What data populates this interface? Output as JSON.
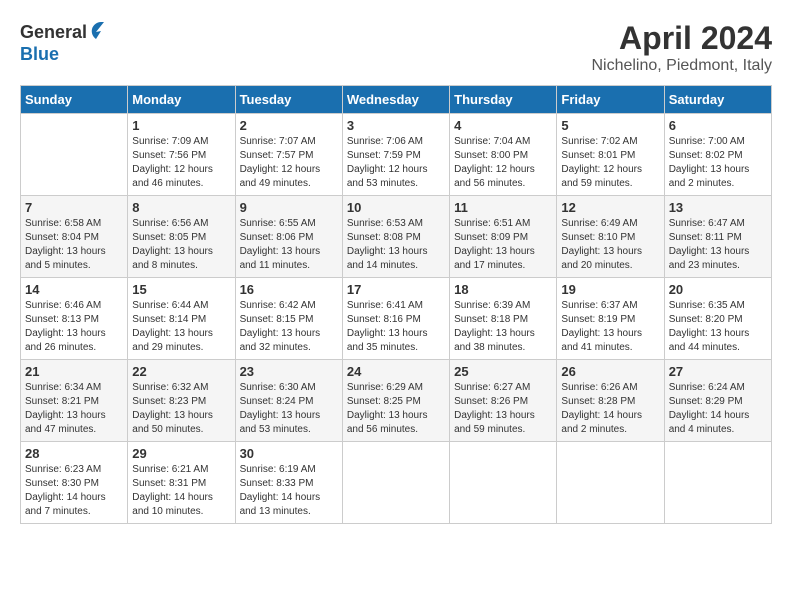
{
  "header": {
    "logo_general": "General",
    "logo_blue": "Blue",
    "month_title": "April 2024",
    "location": "Nichelino, Piedmont, Italy"
  },
  "columns": [
    "Sunday",
    "Monday",
    "Tuesday",
    "Wednesday",
    "Thursday",
    "Friday",
    "Saturday"
  ],
  "weeks": [
    [
      {
        "day": "",
        "info": ""
      },
      {
        "day": "1",
        "info": "Sunrise: 7:09 AM\nSunset: 7:56 PM\nDaylight: 12 hours\nand 46 minutes."
      },
      {
        "day": "2",
        "info": "Sunrise: 7:07 AM\nSunset: 7:57 PM\nDaylight: 12 hours\nand 49 minutes."
      },
      {
        "day": "3",
        "info": "Sunrise: 7:06 AM\nSunset: 7:59 PM\nDaylight: 12 hours\nand 53 minutes."
      },
      {
        "day": "4",
        "info": "Sunrise: 7:04 AM\nSunset: 8:00 PM\nDaylight: 12 hours\nand 56 minutes."
      },
      {
        "day": "5",
        "info": "Sunrise: 7:02 AM\nSunset: 8:01 PM\nDaylight: 12 hours\nand 59 minutes."
      },
      {
        "day": "6",
        "info": "Sunrise: 7:00 AM\nSunset: 8:02 PM\nDaylight: 13 hours\nand 2 minutes."
      }
    ],
    [
      {
        "day": "7",
        "info": "Sunrise: 6:58 AM\nSunset: 8:04 PM\nDaylight: 13 hours\nand 5 minutes."
      },
      {
        "day": "8",
        "info": "Sunrise: 6:56 AM\nSunset: 8:05 PM\nDaylight: 13 hours\nand 8 minutes."
      },
      {
        "day": "9",
        "info": "Sunrise: 6:55 AM\nSunset: 8:06 PM\nDaylight: 13 hours\nand 11 minutes."
      },
      {
        "day": "10",
        "info": "Sunrise: 6:53 AM\nSunset: 8:08 PM\nDaylight: 13 hours\nand 14 minutes."
      },
      {
        "day": "11",
        "info": "Sunrise: 6:51 AM\nSunset: 8:09 PM\nDaylight: 13 hours\nand 17 minutes."
      },
      {
        "day": "12",
        "info": "Sunrise: 6:49 AM\nSunset: 8:10 PM\nDaylight: 13 hours\nand 20 minutes."
      },
      {
        "day": "13",
        "info": "Sunrise: 6:47 AM\nSunset: 8:11 PM\nDaylight: 13 hours\nand 23 minutes."
      }
    ],
    [
      {
        "day": "14",
        "info": "Sunrise: 6:46 AM\nSunset: 8:13 PM\nDaylight: 13 hours\nand 26 minutes."
      },
      {
        "day": "15",
        "info": "Sunrise: 6:44 AM\nSunset: 8:14 PM\nDaylight: 13 hours\nand 29 minutes."
      },
      {
        "day": "16",
        "info": "Sunrise: 6:42 AM\nSunset: 8:15 PM\nDaylight: 13 hours\nand 32 minutes."
      },
      {
        "day": "17",
        "info": "Sunrise: 6:41 AM\nSunset: 8:16 PM\nDaylight: 13 hours\nand 35 minutes."
      },
      {
        "day": "18",
        "info": "Sunrise: 6:39 AM\nSunset: 8:18 PM\nDaylight: 13 hours\nand 38 minutes."
      },
      {
        "day": "19",
        "info": "Sunrise: 6:37 AM\nSunset: 8:19 PM\nDaylight: 13 hours\nand 41 minutes."
      },
      {
        "day": "20",
        "info": "Sunrise: 6:35 AM\nSunset: 8:20 PM\nDaylight: 13 hours\nand 44 minutes."
      }
    ],
    [
      {
        "day": "21",
        "info": "Sunrise: 6:34 AM\nSunset: 8:21 PM\nDaylight: 13 hours\nand 47 minutes."
      },
      {
        "day": "22",
        "info": "Sunrise: 6:32 AM\nSunset: 8:23 PM\nDaylight: 13 hours\nand 50 minutes."
      },
      {
        "day": "23",
        "info": "Sunrise: 6:30 AM\nSunset: 8:24 PM\nDaylight: 13 hours\nand 53 minutes."
      },
      {
        "day": "24",
        "info": "Sunrise: 6:29 AM\nSunset: 8:25 PM\nDaylight: 13 hours\nand 56 minutes."
      },
      {
        "day": "25",
        "info": "Sunrise: 6:27 AM\nSunset: 8:26 PM\nDaylight: 13 hours\nand 59 minutes."
      },
      {
        "day": "26",
        "info": "Sunrise: 6:26 AM\nSunset: 8:28 PM\nDaylight: 14 hours\nand 2 minutes."
      },
      {
        "day": "27",
        "info": "Sunrise: 6:24 AM\nSunset: 8:29 PM\nDaylight: 14 hours\nand 4 minutes."
      }
    ],
    [
      {
        "day": "28",
        "info": "Sunrise: 6:23 AM\nSunset: 8:30 PM\nDaylight: 14 hours\nand 7 minutes."
      },
      {
        "day": "29",
        "info": "Sunrise: 6:21 AM\nSunset: 8:31 PM\nDaylight: 14 hours\nand 10 minutes."
      },
      {
        "day": "30",
        "info": "Sunrise: 6:19 AM\nSunset: 8:33 PM\nDaylight: 14 hours\nand 13 minutes."
      },
      {
        "day": "",
        "info": ""
      },
      {
        "day": "",
        "info": ""
      },
      {
        "day": "",
        "info": ""
      },
      {
        "day": "",
        "info": ""
      }
    ]
  ]
}
